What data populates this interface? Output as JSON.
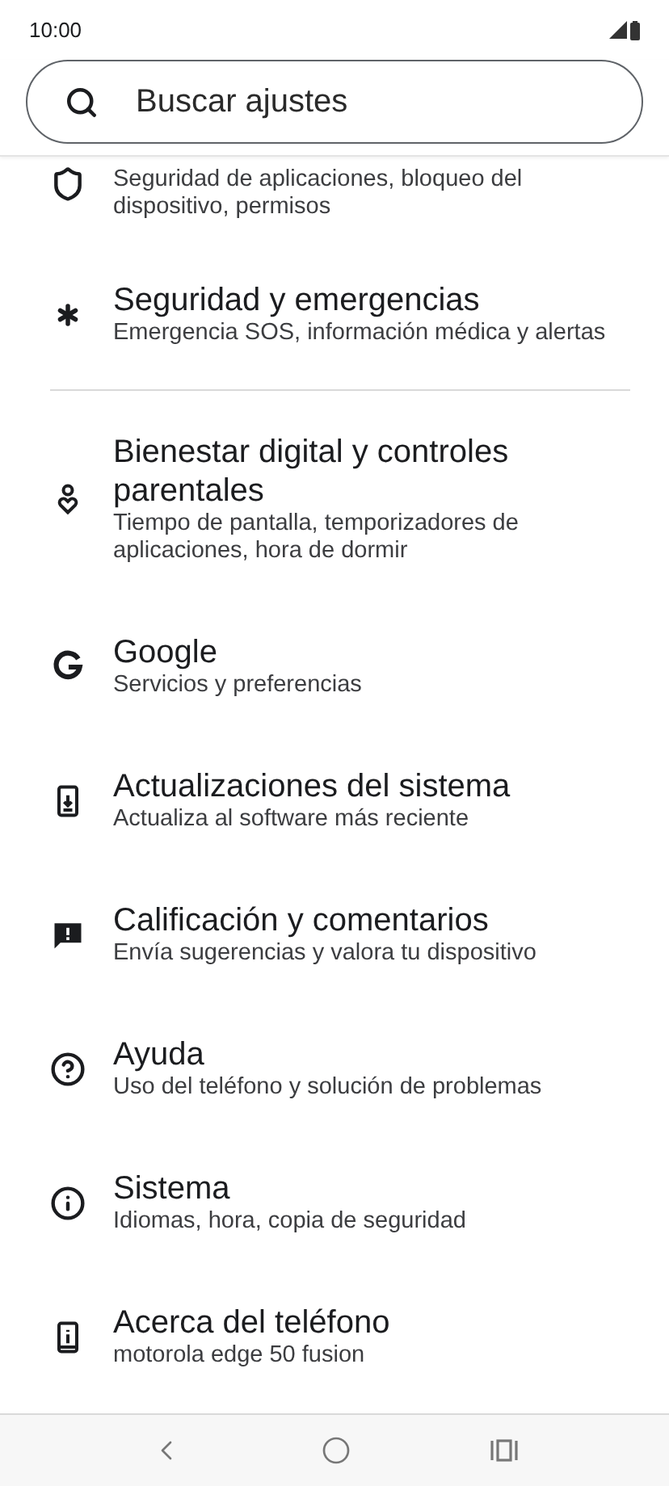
{
  "status_bar": {
    "time": "10:00"
  },
  "search": {
    "placeholder": "Buscar ajustes"
  },
  "items": [
    {
      "subtitle": "Seguridad de aplicaciones, bloqueo del dispositivo, permisos"
    },
    {
      "title": "Seguridad y emergencias",
      "subtitle": "Emergencia SOS, información médica y alertas",
      "divider_after": true
    },
    {
      "title": "Bienestar digital y controles parentales",
      "subtitle": "Tiempo de pantalla, temporizadores de aplicaciones, hora de dormir"
    },
    {
      "title": "Google",
      "subtitle": "Servicios y preferencias"
    },
    {
      "title": "Actualizaciones del sistema",
      "subtitle": "Actualiza al software más reciente"
    },
    {
      "title": "Calificación y comentarios",
      "subtitle": "Envía sugerencias y valora tu dispositivo"
    },
    {
      "title": "Ayuda",
      "subtitle": "Uso del teléfono y solución de problemas"
    },
    {
      "title": "Sistema",
      "subtitle": "Idiomas, hora, copia de seguridad"
    },
    {
      "title": "Acerca del teléfono",
      "subtitle": "motorola edge 50 fusion"
    }
  ]
}
